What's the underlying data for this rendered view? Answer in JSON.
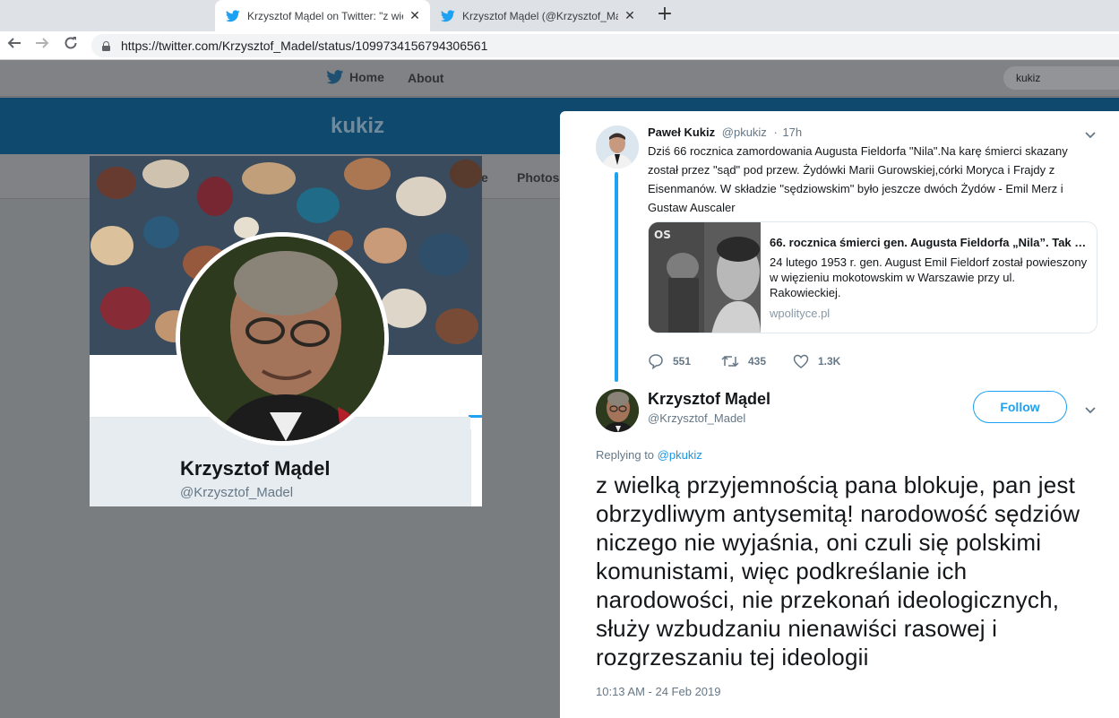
{
  "browser": {
    "tabs": [
      {
        "title": "Krzysztof Mądel on Twitter: \"z wiel",
        "active": true
      },
      {
        "title": "Krzysztof Mądel (@Krzysztof_Mądel",
        "active": false
      }
    ],
    "close_glyph": "✕",
    "new_tab_glyph": "+",
    "url": "https://twitter.com/Krzysztof_Madel/status/1099734156794306561"
  },
  "twitter_nav": {
    "home_label": "Home",
    "about_label": "About",
    "search_value": "kukiz"
  },
  "banner": {
    "title": "kukiz"
  },
  "profile_nav": {
    "tab_fragment": "e",
    "photos_label": "Photos"
  },
  "profile_card": {
    "name": "Krzysztof Mądel",
    "handle": "@Krzysztof_Madel"
  },
  "context_tweet": {
    "author_name": "Paweł Kukiz",
    "author_handle": "@pkukiz",
    "separator": "·",
    "time_ago": "17h",
    "text": "Dziś 66 rocznica zamordowania Augusta Fieldorfa \"Nila\".Na karę śmierci skazany został przez \"sąd\" pod przew. Żydówki Marii Gurowskiej,córki Moryca i Frajdy  z Eisenmanów. W składzie \"sędziowskim\" było jeszcze dwóch Żydów - Emil Merz i Gustaw Auscaler",
    "link_card": {
      "title": "66. rocznica śmierci gen. Augusta Fieldorfa „Nila”. Tak walczył o wolną Polskę",
      "description": "24 lutego 1953 r. gen. August Emil Fieldorf został powieszony w więzieniu mokotowskim w Warszawie przy ul. Rakowieckiej.",
      "domain": "wpolityce.pl",
      "thumb_caption": "OS"
    },
    "stats": {
      "replies": "551",
      "retweets": "435",
      "likes": "1.3K"
    }
  },
  "main_tweet": {
    "author_name": "Krzysztof Mądel",
    "author_handle": "@Krzysztof_Madel",
    "follow_label": "Follow",
    "replying_prefix": "Replying to",
    "replying_to": "@pkukiz",
    "text": "z wielką przyjemnością pana blokuje, pan jest obrzydliwym antysemitą! narodowość sędziów niczego nie wyjaśnia, oni czuli się polskimi komunistami, więc podkreślanie ich narodowości, nie przekonań ideologicznych, służy wzbudzaniu nienawiści rasowej i rozgrzeszaniu tej ideologii",
    "timestamp": "10:13 AM - 24 Feb 2019"
  },
  "colors": {
    "twitter_blue": "#1da1f2",
    "banner_blue": "#0f4a6e",
    "dim_gray": "#7a7d80"
  },
  "icons": {
    "tab_favicon": "twitter-bird-icon",
    "back": "back-arrow-icon",
    "forward": "forward-arrow-icon",
    "reload": "reload-icon",
    "secure": "lock-icon",
    "home": "twitter-bird-icon",
    "caret": "chevron-down-icon",
    "reply": "reply-icon",
    "retweet": "retweet-icon",
    "like": "heart-icon"
  }
}
